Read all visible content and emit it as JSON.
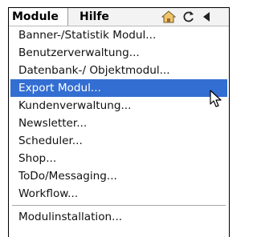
{
  "menubar": {
    "menus": [
      "Module",
      "Hilfe"
    ],
    "icons": [
      "home-icon",
      "refresh-icon",
      "back-arrow-icon"
    ]
  },
  "dropdown": {
    "items": [
      "Banner-/Statistik Modul...",
      "Benutzerverwaltung...",
      "Datenbank-/ Objektmodul...",
      "Export Modul...",
      "Kundenverwaltung...",
      "Newsletter...",
      "Scheduler...",
      "Shop...",
      "ToDo/Messaging...",
      "Workflow..."
    ],
    "selected_item": "Export Modul...",
    "after_separator": [
      "Modulinstallation..."
    ]
  },
  "colors": {
    "selection": "#336ed2",
    "menubar_bg": "#f3f3f3"
  }
}
